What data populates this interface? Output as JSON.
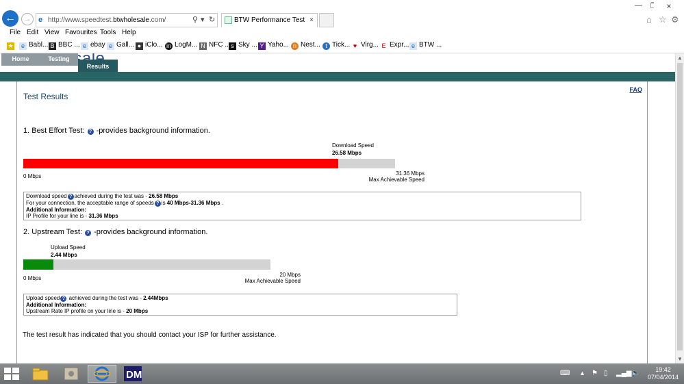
{
  "browser": {
    "address_prefix": "http://www.speedtest.",
    "address_domain": "btwholesale",
    "address_suffix": ".com/",
    "tab_title": "BTW Performance Test",
    "menu": [
      "File",
      "Edit",
      "View",
      "Favourites",
      "Tools",
      "Help"
    ],
    "favourites": [
      "Babl...",
      "BBC ...",
      "ebay",
      "Gall...",
      "iClo...",
      "LogM...",
      "NFC ...",
      "Sky ...",
      "Yaho...",
      "Nest...",
      "Tick...",
      "Virg...",
      "Expr...",
      "BTW ..."
    ]
  },
  "site": {
    "brand": "wholesale",
    "nav": {
      "home": "Home",
      "testing": "Testing",
      "results": "Results"
    },
    "faq": "FAQ",
    "results_title": "Test Results"
  },
  "best_effort": {
    "title_prefix": "1. Best Effort Test:",
    "title_suffix": "-provides background information.",
    "bar_label_top": "Download Speed",
    "bar_value": "26.58 Mbps",
    "min_label": "0 Mbps",
    "max_value": "31.36 Mbps",
    "max_label": "Max Achievable Speed",
    "fill_fraction": 0.8476,
    "fill_color": "#ff0000",
    "info": {
      "line1_pre": "Download speed",
      "line1_mid": "achieved during the test was - ",
      "line1_val": "26.58 Mbps",
      "line2_pre": "For your connection, the acceptable range of speeds",
      "line2_mid": "is ",
      "line2_val": "40 Mbps-31.36 Mbps",
      "line2_end": " .",
      "line3": "Additional Information:",
      "line4_pre": "IP Profile for your line is - ",
      "line4_val": "31.36 Mbps"
    }
  },
  "upstream": {
    "title_prefix": "2. Upstream Test:",
    "title_suffix": "-provides background information.",
    "bar_label_top": "Upload Speed",
    "bar_value": "2.44 Mbps",
    "min_label": "0 Mbps",
    "max_value": "20 Mbps",
    "max_label": "Max Achievable Speed",
    "fill_fraction": 0.122,
    "fill_color": "#0a8a0a",
    "info": {
      "line1_pre": "Upload speed",
      "line1_mid": " achieved during the test was - ",
      "line1_val": "2.44Mbps",
      "line3": "Additional Information:",
      "line4_pre": "Upstream Rate IP profile on your line is - ",
      "line4_val": "20 Mbps"
    }
  },
  "final_message": "The test result has indicated that you should contact your ISP for further assistance.",
  "taskbar": {
    "time": "19:42",
    "date": "07/04/2014"
  }
}
